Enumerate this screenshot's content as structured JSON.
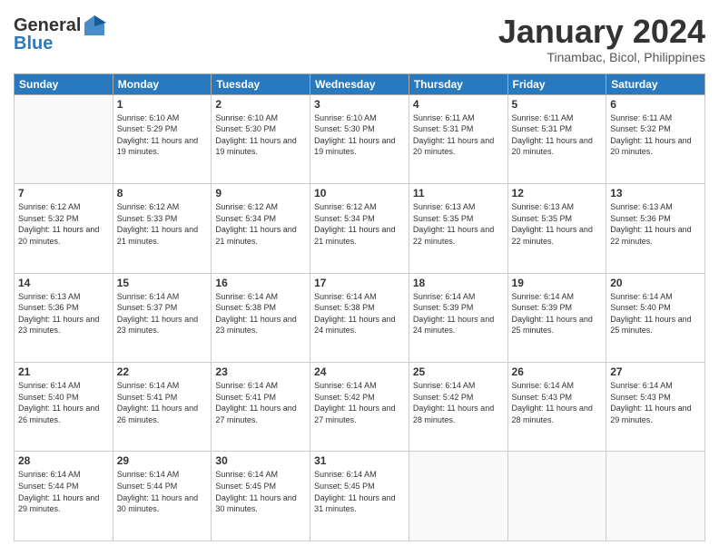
{
  "logo": {
    "general": "General",
    "blue": "Blue"
  },
  "title": "January 2024",
  "subtitle": "Tinambac, Bicol, Philippines",
  "days_header": [
    "Sunday",
    "Monday",
    "Tuesday",
    "Wednesday",
    "Thursday",
    "Friday",
    "Saturday"
  ],
  "weeks": [
    [
      {
        "num": "",
        "sunrise": "",
        "sunset": "",
        "daylight": ""
      },
      {
        "num": "1",
        "sunrise": "Sunrise: 6:10 AM",
        "sunset": "Sunset: 5:29 PM",
        "daylight": "Daylight: 11 hours and 19 minutes."
      },
      {
        "num": "2",
        "sunrise": "Sunrise: 6:10 AM",
        "sunset": "Sunset: 5:30 PM",
        "daylight": "Daylight: 11 hours and 19 minutes."
      },
      {
        "num": "3",
        "sunrise": "Sunrise: 6:10 AM",
        "sunset": "Sunset: 5:30 PM",
        "daylight": "Daylight: 11 hours and 19 minutes."
      },
      {
        "num": "4",
        "sunrise": "Sunrise: 6:11 AM",
        "sunset": "Sunset: 5:31 PM",
        "daylight": "Daylight: 11 hours and 20 minutes."
      },
      {
        "num": "5",
        "sunrise": "Sunrise: 6:11 AM",
        "sunset": "Sunset: 5:31 PM",
        "daylight": "Daylight: 11 hours and 20 minutes."
      },
      {
        "num": "6",
        "sunrise": "Sunrise: 6:11 AM",
        "sunset": "Sunset: 5:32 PM",
        "daylight": "Daylight: 11 hours and 20 minutes."
      }
    ],
    [
      {
        "num": "7",
        "sunrise": "Sunrise: 6:12 AM",
        "sunset": "Sunset: 5:32 PM",
        "daylight": "Daylight: 11 hours and 20 minutes."
      },
      {
        "num": "8",
        "sunrise": "Sunrise: 6:12 AM",
        "sunset": "Sunset: 5:33 PM",
        "daylight": "Daylight: 11 hours and 21 minutes."
      },
      {
        "num": "9",
        "sunrise": "Sunrise: 6:12 AM",
        "sunset": "Sunset: 5:34 PM",
        "daylight": "Daylight: 11 hours and 21 minutes."
      },
      {
        "num": "10",
        "sunrise": "Sunrise: 6:12 AM",
        "sunset": "Sunset: 5:34 PM",
        "daylight": "Daylight: 11 hours and 21 minutes."
      },
      {
        "num": "11",
        "sunrise": "Sunrise: 6:13 AM",
        "sunset": "Sunset: 5:35 PM",
        "daylight": "Daylight: 11 hours and 22 minutes."
      },
      {
        "num": "12",
        "sunrise": "Sunrise: 6:13 AM",
        "sunset": "Sunset: 5:35 PM",
        "daylight": "Daylight: 11 hours and 22 minutes."
      },
      {
        "num": "13",
        "sunrise": "Sunrise: 6:13 AM",
        "sunset": "Sunset: 5:36 PM",
        "daylight": "Daylight: 11 hours and 22 minutes."
      }
    ],
    [
      {
        "num": "14",
        "sunrise": "Sunrise: 6:13 AM",
        "sunset": "Sunset: 5:36 PM",
        "daylight": "Daylight: 11 hours and 23 minutes."
      },
      {
        "num": "15",
        "sunrise": "Sunrise: 6:14 AM",
        "sunset": "Sunset: 5:37 PM",
        "daylight": "Daylight: 11 hours and 23 minutes."
      },
      {
        "num": "16",
        "sunrise": "Sunrise: 6:14 AM",
        "sunset": "Sunset: 5:38 PM",
        "daylight": "Daylight: 11 hours and 23 minutes."
      },
      {
        "num": "17",
        "sunrise": "Sunrise: 6:14 AM",
        "sunset": "Sunset: 5:38 PM",
        "daylight": "Daylight: 11 hours and 24 minutes."
      },
      {
        "num": "18",
        "sunrise": "Sunrise: 6:14 AM",
        "sunset": "Sunset: 5:39 PM",
        "daylight": "Daylight: 11 hours and 24 minutes."
      },
      {
        "num": "19",
        "sunrise": "Sunrise: 6:14 AM",
        "sunset": "Sunset: 5:39 PM",
        "daylight": "Daylight: 11 hours and 25 minutes."
      },
      {
        "num": "20",
        "sunrise": "Sunrise: 6:14 AM",
        "sunset": "Sunset: 5:40 PM",
        "daylight": "Daylight: 11 hours and 25 minutes."
      }
    ],
    [
      {
        "num": "21",
        "sunrise": "Sunrise: 6:14 AM",
        "sunset": "Sunset: 5:40 PM",
        "daylight": "Daylight: 11 hours and 26 minutes."
      },
      {
        "num": "22",
        "sunrise": "Sunrise: 6:14 AM",
        "sunset": "Sunset: 5:41 PM",
        "daylight": "Daylight: 11 hours and 26 minutes."
      },
      {
        "num": "23",
        "sunrise": "Sunrise: 6:14 AM",
        "sunset": "Sunset: 5:41 PM",
        "daylight": "Daylight: 11 hours and 27 minutes."
      },
      {
        "num": "24",
        "sunrise": "Sunrise: 6:14 AM",
        "sunset": "Sunset: 5:42 PM",
        "daylight": "Daylight: 11 hours and 27 minutes."
      },
      {
        "num": "25",
        "sunrise": "Sunrise: 6:14 AM",
        "sunset": "Sunset: 5:42 PM",
        "daylight": "Daylight: 11 hours and 28 minutes."
      },
      {
        "num": "26",
        "sunrise": "Sunrise: 6:14 AM",
        "sunset": "Sunset: 5:43 PM",
        "daylight": "Daylight: 11 hours and 28 minutes."
      },
      {
        "num": "27",
        "sunrise": "Sunrise: 6:14 AM",
        "sunset": "Sunset: 5:43 PM",
        "daylight": "Daylight: 11 hours and 29 minutes."
      }
    ],
    [
      {
        "num": "28",
        "sunrise": "Sunrise: 6:14 AM",
        "sunset": "Sunset: 5:44 PM",
        "daylight": "Daylight: 11 hours and 29 minutes."
      },
      {
        "num": "29",
        "sunrise": "Sunrise: 6:14 AM",
        "sunset": "Sunset: 5:44 PM",
        "daylight": "Daylight: 11 hours and 30 minutes."
      },
      {
        "num": "30",
        "sunrise": "Sunrise: 6:14 AM",
        "sunset": "Sunset: 5:45 PM",
        "daylight": "Daylight: 11 hours and 30 minutes."
      },
      {
        "num": "31",
        "sunrise": "Sunrise: 6:14 AM",
        "sunset": "Sunset: 5:45 PM",
        "daylight": "Daylight: 11 hours and 31 minutes."
      },
      {
        "num": "",
        "sunrise": "",
        "sunset": "",
        "daylight": ""
      },
      {
        "num": "",
        "sunrise": "",
        "sunset": "",
        "daylight": ""
      },
      {
        "num": "",
        "sunrise": "",
        "sunset": "",
        "daylight": ""
      }
    ]
  ]
}
